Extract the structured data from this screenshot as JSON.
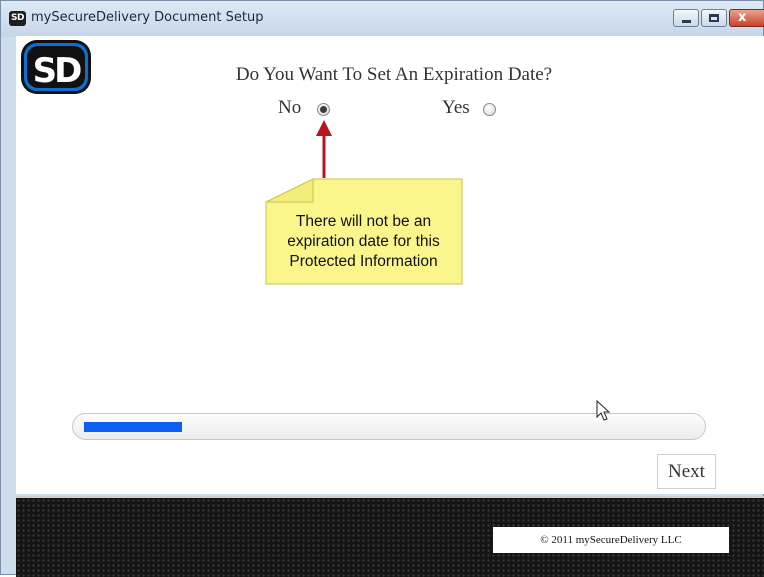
{
  "window": {
    "title": "mySecureDelivery Document Setup",
    "app_badge": "SD",
    "close_glyph": "x"
  },
  "logo": {
    "text": "SD"
  },
  "question": "Do You Want To Set An Expiration Date?",
  "options": [
    {
      "label": "No",
      "selected": true
    },
    {
      "label": "Yes",
      "selected": false
    }
  ],
  "callout": {
    "lines": [
      "There will not be an",
      "expiration date for this",
      "Protected Information"
    ],
    "color": "#fbf68c"
  },
  "progress": {
    "percent": 16,
    "color": "#0d5ff2"
  },
  "next_button": {
    "label": "Next"
  },
  "footer": {
    "copyright": "© 2011 mySecureDelivery LLC"
  }
}
